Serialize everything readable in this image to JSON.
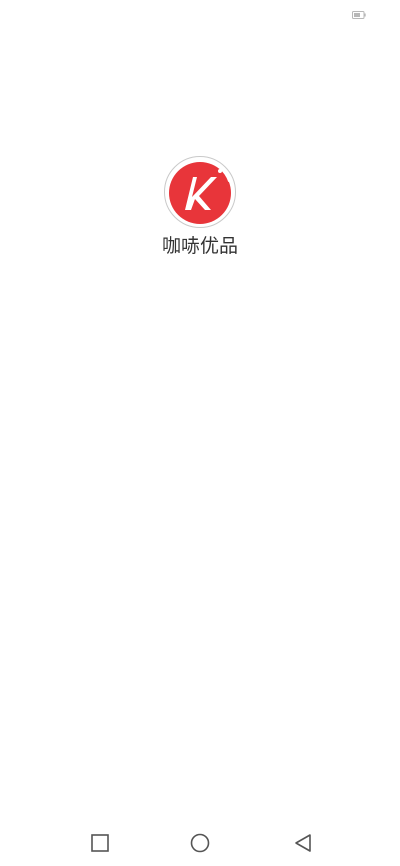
{
  "app": {
    "name": "咖哧优品",
    "logo_letter": "K"
  },
  "colors": {
    "logo_red": "#e8353a",
    "logo_ring": "#c9c9c9",
    "nav_icon": "#555555",
    "text": "#333333",
    "battery": "#b8b8b8"
  },
  "status_bar": {
    "battery_icon": "battery-icon"
  },
  "nav_bar": {
    "recents_icon": "square-icon",
    "home_icon": "circle-icon",
    "back_icon": "triangle-left-icon"
  }
}
